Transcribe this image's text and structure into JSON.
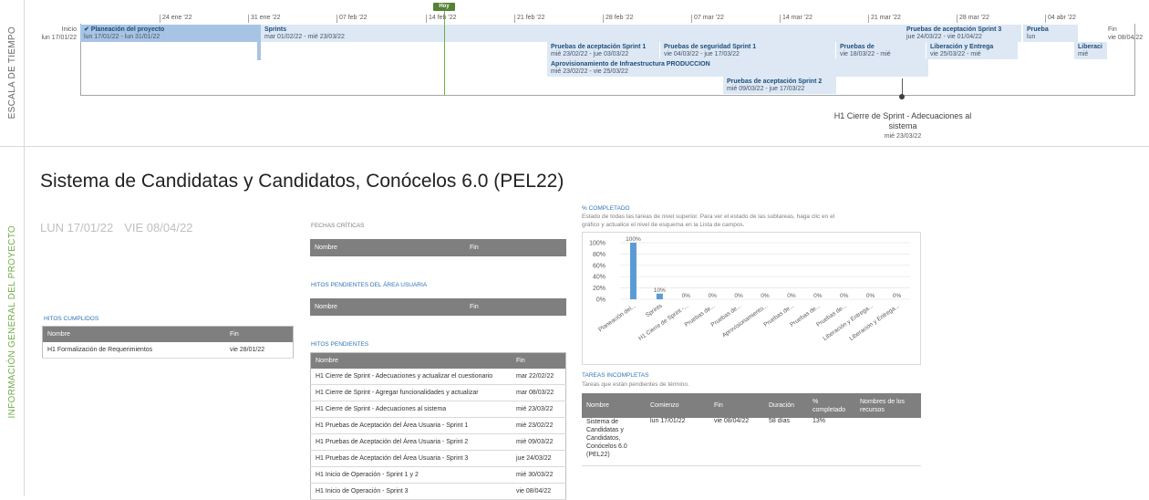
{
  "sidebar": {
    "timescale_label": "ESCALA DE TIEMPO",
    "info_label": "INFORMACIÓN GENERAL DEL PROYECTO"
  },
  "timeline": {
    "start_label": "Inicio",
    "start_date": "lun 17/01/22",
    "end_label": "Fin",
    "end_date": "vie 08/04/22",
    "today_label": "Hoy",
    "ticks": [
      "24 ene '22",
      "31 ene '22",
      "07 feb '22",
      "14 feb '22",
      "21 feb '22",
      "28 feb '22",
      "07 mar '22",
      "14 mar '22",
      "21 mar '22",
      "28 mar '22",
      "04 abr '22"
    ],
    "bars": [
      {
        "title": "✔ Planeación del proyecto",
        "dates": "lun 17/01/22 - lun 31/01/22"
      },
      {
        "title": "Sprints",
        "dates": "mar 01/02/22 - mié 23/03/22"
      },
      {
        "title": "Pruebas de aceptación Sprint  1",
        "dates": "mié 23/02/22 - jue 03/03/22"
      },
      {
        "title": "Pruebas de seguridad Sprint 1",
        "dates": "vie 04/03/22 - jue 17/03/22"
      },
      {
        "title": "Pruebas de",
        "dates": "vie 18/03/22 - mié"
      },
      {
        "title": "Pruebas de aceptación Sprint 3",
        "dates": "jue 24/03/22 - vie 01/04/22"
      },
      {
        "title": "Prueba",
        "dates": "lun"
      },
      {
        "title": "Liberaci",
        "dates": "mié"
      },
      {
        "title": "Aprovisionamiento de Infraestructura PRODUCCION",
        "dates": "mié 23/02/22 - vie 25/03/22"
      },
      {
        "title": "Liberación y Entrega",
        "dates": "vie 25/03/22 - mié"
      },
      {
        "title": "Pruebas de aceptación Sprint 2",
        "dates": "mié 09/03/22 - jue 17/03/22"
      }
    ],
    "milestone": {
      "title": "H1 Cierre de Sprint - Adecuaciones al sistema",
      "date": "mié 23/03/22"
    }
  },
  "project": {
    "title": "Sistema de Candidatas y Candidatos, Conócelos 6.0 (PEL22)",
    "start": "LUN 17/01/22",
    "finish": "VIE 08/04/22"
  },
  "hitos_cumplidos": {
    "heading": "HITOS CUMPLIDOS",
    "columns": [
      "Nombre",
      "Fin"
    ],
    "rows": [
      [
        "H1 Formalización de Requerimientos",
        "vie 28/01/22"
      ]
    ]
  },
  "fechas_criticas": {
    "heading": "FECHAS CRÍTICAS",
    "columns": [
      "Nombre",
      "Fin"
    ]
  },
  "hitos_area_usuaria": {
    "heading": "HITOS PENDIENTES DEL ÁREA USUARIA",
    "columns": [
      "Nombre",
      "Fin"
    ]
  },
  "hitos_pendientes": {
    "heading": "HITOS PENDIENTES",
    "columns": [
      "Nombre",
      "Fin"
    ],
    "rows": [
      [
        "H1 Cierre de Sprint - Adecuaciones y actualizar el cuestionario",
        "mar 22/02/22"
      ],
      [
        "H1 Cierre de Sprint - Agregar funcionalidades y actualizar",
        "mar 08/03/22"
      ],
      [
        "H1 Cierre de Sprint - Adecuaciones al sistema",
        "mié 23/03/22"
      ],
      [
        "H1 Pruebas de Aceptación del Área Usuaria - Sprint 1",
        "mié 23/02/22"
      ],
      [
        "H1 Pruebas de Aceptación del Área Usuaria - Sprint 2",
        "mié 09/03/22"
      ],
      [
        "H1 Pruebas de Aceptación del Área Usuaria - Sprint 3",
        "jue 24/03/22"
      ],
      [
        "H1 Inicio de Operación - Sprint 1 y 2",
        "mié 30/03/22"
      ],
      [
        "H1 Inicio de Operación - Sprint 3",
        "vie 08/04/22"
      ]
    ]
  },
  "completado": {
    "heading": "% COMPLETADO",
    "desc_line1": "Estado de todas las tareas de nivel superior. Para ver el estado de las subtareas, haga clic en el",
    "desc_line2": "gráfico y actualice el nivel de esquema en la Lista de campos."
  },
  "chart_data": {
    "type": "bar",
    "categories": [
      "Planeación del...",
      "Sprints",
      "H1 Cierre de Sprint -...",
      "Pruebas de...",
      "Pruebas de...",
      "Aprovisionamiento...",
      "Pruebas de...",
      "Pruebas de...",
      "Pruebas de...",
      "Liberación y Entrega...",
      "Liberación y Entrega..."
    ],
    "values": [
      100,
      10,
      0,
      0,
      0,
      0,
      0,
      0,
      0,
      0,
      0
    ],
    "data_labels": [
      "100%",
      "10%",
      "0%",
      "0%",
      "0%",
      "0%",
      "0%",
      "0%",
      "0%",
      "0%",
      "0%"
    ],
    "y_ticks": [
      "0%",
      "10%",
      "20%",
      "30%",
      "40%",
      "50%",
      "60%",
      "70%",
      "80%",
      "90%",
      "100%"
    ],
    "ylim": [
      0,
      100
    ],
    "color": "#5b9bd5",
    "grid": true
  },
  "tareas_incompletas": {
    "heading": "TAREAS INCOMPLETAS",
    "desc": "Tareas que están pendientes de término.",
    "columns": [
      "Nombre",
      "Comienzo",
      "Fin",
      "Duración",
      "% completado",
      "Nombres de los recursos"
    ],
    "row": {
      "nombre": "Sistema de Candidatas y Candidatos, Conócelos 6.0 (PEL22)",
      "comienzo": "lun 17/01/22",
      "fin": "vie 08/04/22",
      "duracion": "58 días",
      "completado": "13%",
      "recursos": ""
    }
  }
}
